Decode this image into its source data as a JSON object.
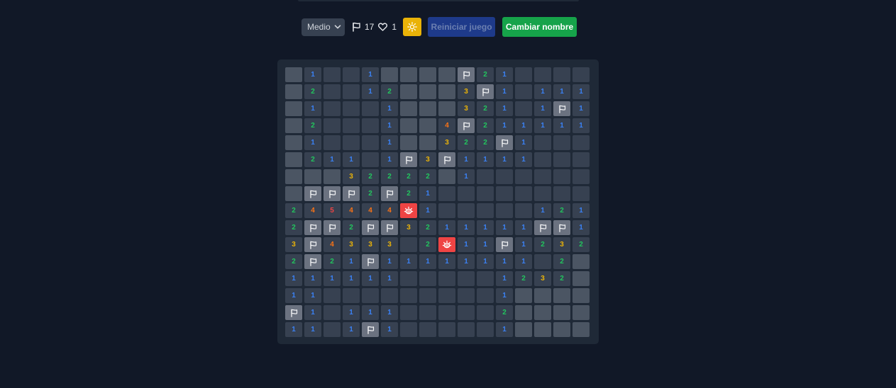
{
  "controls": {
    "difficulty": "Medio",
    "flags_count": "17",
    "lives_count": "1",
    "theme_icon": "sun-icon",
    "reset_label": "Reiniciar juego",
    "rename_label": "Cambiar nombre"
  },
  "colors": {
    "background": "#111827",
    "board": "#1f2937",
    "covered_cell": "#4b5563",
    "revealed_cell": "#374151",
    "flagged_cell": "#6b7280",
    "mine_cell": "#ef4444",
    "number_1": "#3b82f6",
    "number_2": "#22c55e",
    "number_3": "#eab308",
    "number_4": "#f97316",
    "number_5": "#ef4444",
    "theme_button": "#eab308",
    "reset_button": "#1e3a8a",
    "rename_button": "#16a34a"
  },
  "board": {
    "legend": "C = covered, F = flag, M = mine, . = empty revealed, digit = revealed count",
    "rows": [
      "C1..1CCCCF21....",
      "C2..12CCC3F1.111",
      "C1...1CCC321.1F1",
      "C2...1CC4F211111",
      "C1...1CC322F1...",
      "C211.1F3F1111...",
      "CCC32222C1......",
      "CFFF2F21........",
      "245444M1.....121",
      "2FF2FF3211111FF1",
      "3F4333.2M11F1232",
      "2F21F11111111.2C",
      "111111.....1232C",
      "11.........1CCCC",
      "F1.111.....2CCCC",
      "11.1F1.....1CCCC"
    ]
  }
}
